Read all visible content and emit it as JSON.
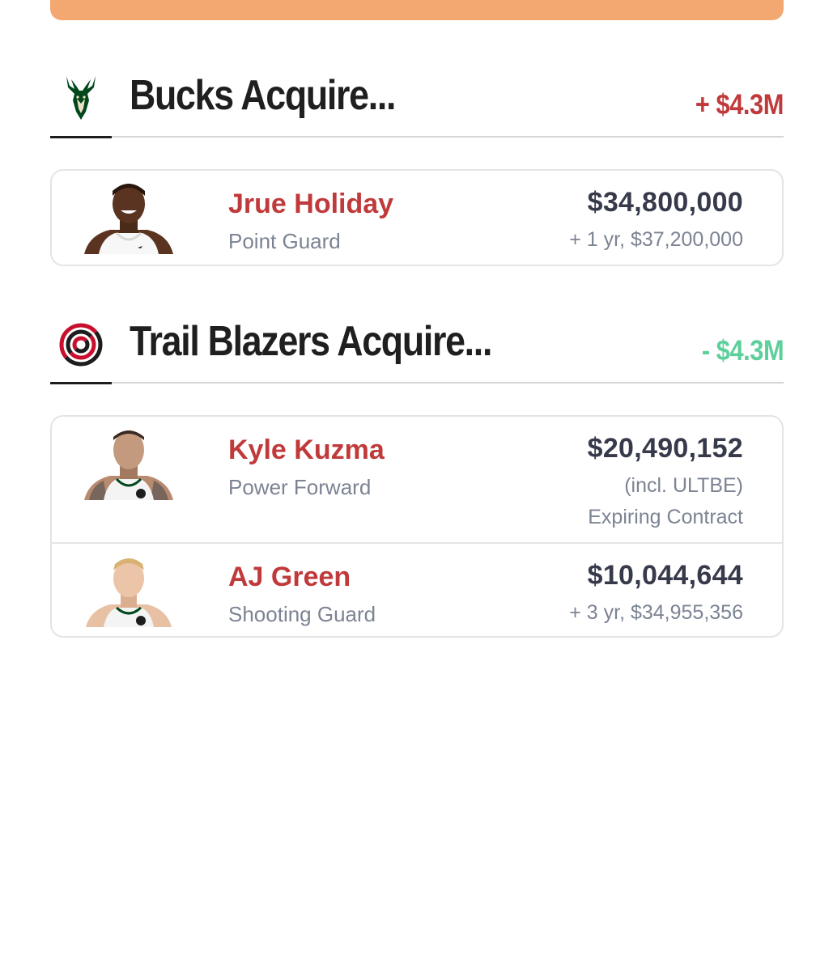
{
  "colors": {
    "top_bar": "#f2a870",
    "name_red": "#c0393b",
    "delta_positive": "#c0393b",
    "delta_negative": "#5ccf9a",
    "bucks_green": "#00471b",
    "blazers_red": "#c8102e"
  },
  "teams": [
    {
      "name": "Bucks Acquire...",
      "logo_icon": "bucks-deer-logo-icon",
      "salary_delta": "+ $4.3M",
      "players": [
        {
          "name": "Jrue Holiday",
          "position": "Point Guard",
          "salary": "$34,800,000",
          "detail": "+ 1 yr, $37,200,000"
        }
      ]
    },
    {
      "name": "Trail Blazers Acquire...",
      "logo_icon": "blazers-pinwheel-logo-icon",
      "salary_delta": "- $4.3M",
      "players": [
        {
          "name": "Kyle Kuzma",
          "position": "Power Forward",
          "salary": "$20,490,152",
          "detail": "(incl. ULTBE)",
          "detail2": "Expiring Contract"
        },
        {
          "name": "AJ Green",
          "position": "Shooting Guard",
          "salary": "$10,044,644",
          "detail": "+ 3 yr, $34,955,356"
        }
      ]
    }
  ]
}
